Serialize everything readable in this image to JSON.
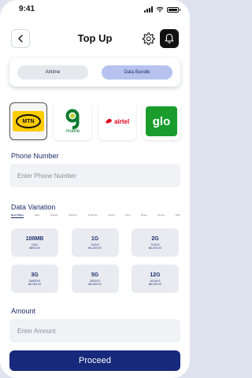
{
  "status": {
    "time": "9:41"
  },
  "header": {
    "title": "Top Up"
  },
  "toggle": {
    "airtime_label": "Airtime",
    "data_label": "Data Bundle"
  },
  "networks": {
    "mtn": "MTN",
    "nine_mobile": "mobile",
    "airtel": "airtel",
    "glo": "glo"
  },
  "phone": {
    "label": "Phone Number",
    "placeholder": "Enter Phone Number"
  },
  "data_variation": {
    "title": "Data Variation",
    "tabs": [
      "Best Offers",
      "Daily",
      "Weekly",
      "Monthly",
      "3 Months",
      "Social",
      "Flexi",
      "Binge",
      "Router",
      "WiFi"
    ]
  },
  "plans": [
    {
      "size": "100MB",
      "validity": "1DAY",
      "price": "₦500.00"
    },
    {
      "size": "1G",
      "validity": "7DAYS",
      "price": "₦1,000.00"
    },
    {
      "size": "2G",
      "validity": "7DAYS",
      "price": "₦1,500.00"
    },
    {
      "size": "3G",
      "validity": "2WEEKS",
      "price": "₦2,000.00"
    },
    {
      "size": "5G",
      "validity": "30DAYS",
      "price": "₦3,000.00"
    },
    {
      "size": "12G",
      "validity": "30DAYS",
      "price": "₦5,000.00"
    }
  ],
  "amount": {
    "label": "Amount",
    "placeholder": "Enter Amount"
  },
  "proceed": {
    "label": "Proceed"
  },
  "colors": {
    "primary": "#16297a",
    "accent": "#b7c3ee",
    "input_bg": "#f1f2f6",
    "mtn": "#ffcc00",
    "glo": "#1a9c2d",
    "airtel": "#e2001a"
  }
}
